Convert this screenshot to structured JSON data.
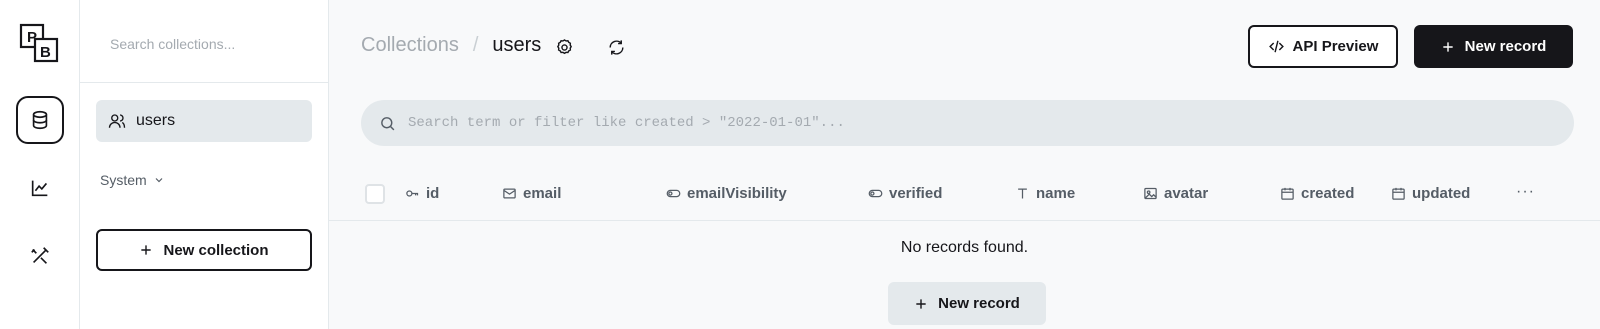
{
  "rail": {
    "logo_letters": [
      "P",
      "B"
    ],
    "items": [
      {
        "icon": "database-icon",
        "active": true
      },
      {
        "icon": "chart-icon",
        "active": false
      },
      {
        "icon": "tools-icon",
        "active": false
      }
    ]
  },
  "sidebar": {
    "search_placeholder": "Search collections...",
    "collections": [
      {
        "label": "users",
        "icon": "users-icon"
      }
    ],
    "system_label": "System",
    "new_collection_label": "New collection"
  },
  "header": {
    "breadcrumb_root": "Collections",
    "breadcrumb_separator": "/",
    "breadcrumb_current": "users",
    "api_preview_label": "API Preview",
    "new_record_label": "New record"
  },
  "search": {
    "placeholder": "Search term or filter like created > \"2022-01-01\"..."
  },
  "table": {
    "columns": [
      {
        "label": "id",
        "icon": "key-icon"
      },
      {
        "label": "email",
        "icon": "mail-icon"
      },
      {
        "label": "emailVisibility",
        "icon": "toggle-icon"
      },
      {
        "label": "verified",
        "icon": "toggle-icon"
      },
      {
        "label": "name",
        "icon": "text-icon"
      },
      {
        "label": "avatar",
        "icon": "image-icon"
      },
      {
        "label": "created",
        "icon": "calendar-icon"
      },
      {
        "label": "updated",
        "icon": "calendar-icon"
      }
    ],
    "more_label": "···",
    "empty_text": "No records found.",
    "empty_new_record_label": "New record"
  },
  "colors": {
    "dark": "#16161a",
    "muted": "#a4aab0",
    "surface": "#e4e9ec",
    "background": "#f8f9fa"
  }
}
